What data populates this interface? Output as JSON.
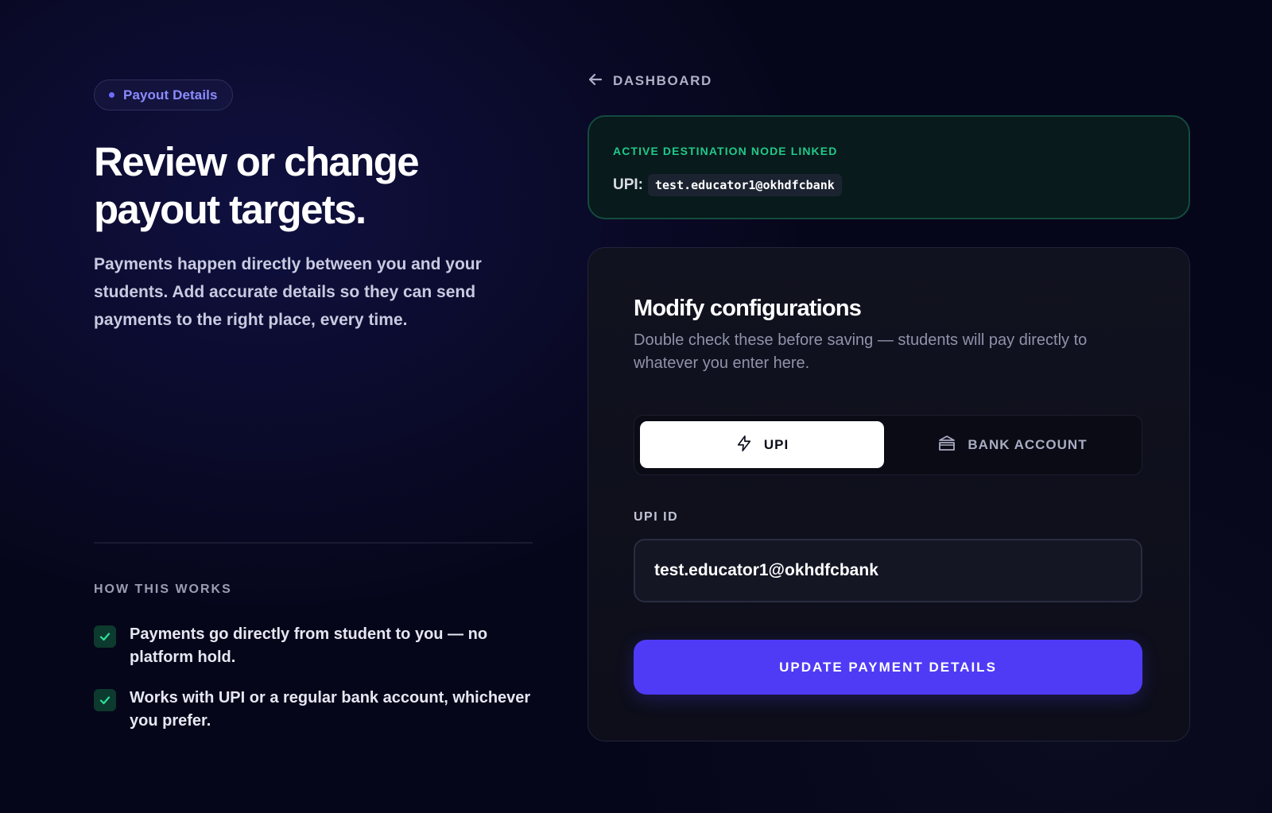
{
  "pill": {
    "label": "Payout Details"
  },
  "hero": {
    "headline": "Review or change payout targets.",
    "lead": "Payments happen directly between you and your students. Add accurate details so they can send payments to the right place, every time."
  },
  "how_it_works": {
    "title": "HOW THIS WORKS",
    "items": [
      {
        "text": "Payments go directly from student to you — no platform hold."
      },
      {
        "text": "Works with UPI or a regular bank account, whichever you prefer."
      }
    ]
  },
  "nav": {
    "back_label": "DASHBOARD",
    "icon": "arrow-left-icon"
  },
  "linked_card": {
    "status": "ACTIVE DESTINATION NODE LINKED",
    "upi_label": "UPI:",
    "upi_value": "test.educator1@okhdfcbank",
    "accent": "#21c98a"
  },
  "form": {
    "title": "Modify configurations",
    "subtitle": "Double check these before saving — students will pay directly to whatever you enter here.",
    "tabs": [
      {
        "label": "UPI",
        "icon": "lightning-icon",
        "selected": true
      },
      {
        "label": "BANK ACCOUNT",
        "icon": "bank-icon",
        "selected": false
      }
    ],
    "upi_field": {
      "label": "UPI ID",
      "value": "test.educator1@okhdfcbank"
    },
    "submit_label": "UPDATE PAYMENT DETAILS",
    "accent": "#4f3bf5"
  }
}
